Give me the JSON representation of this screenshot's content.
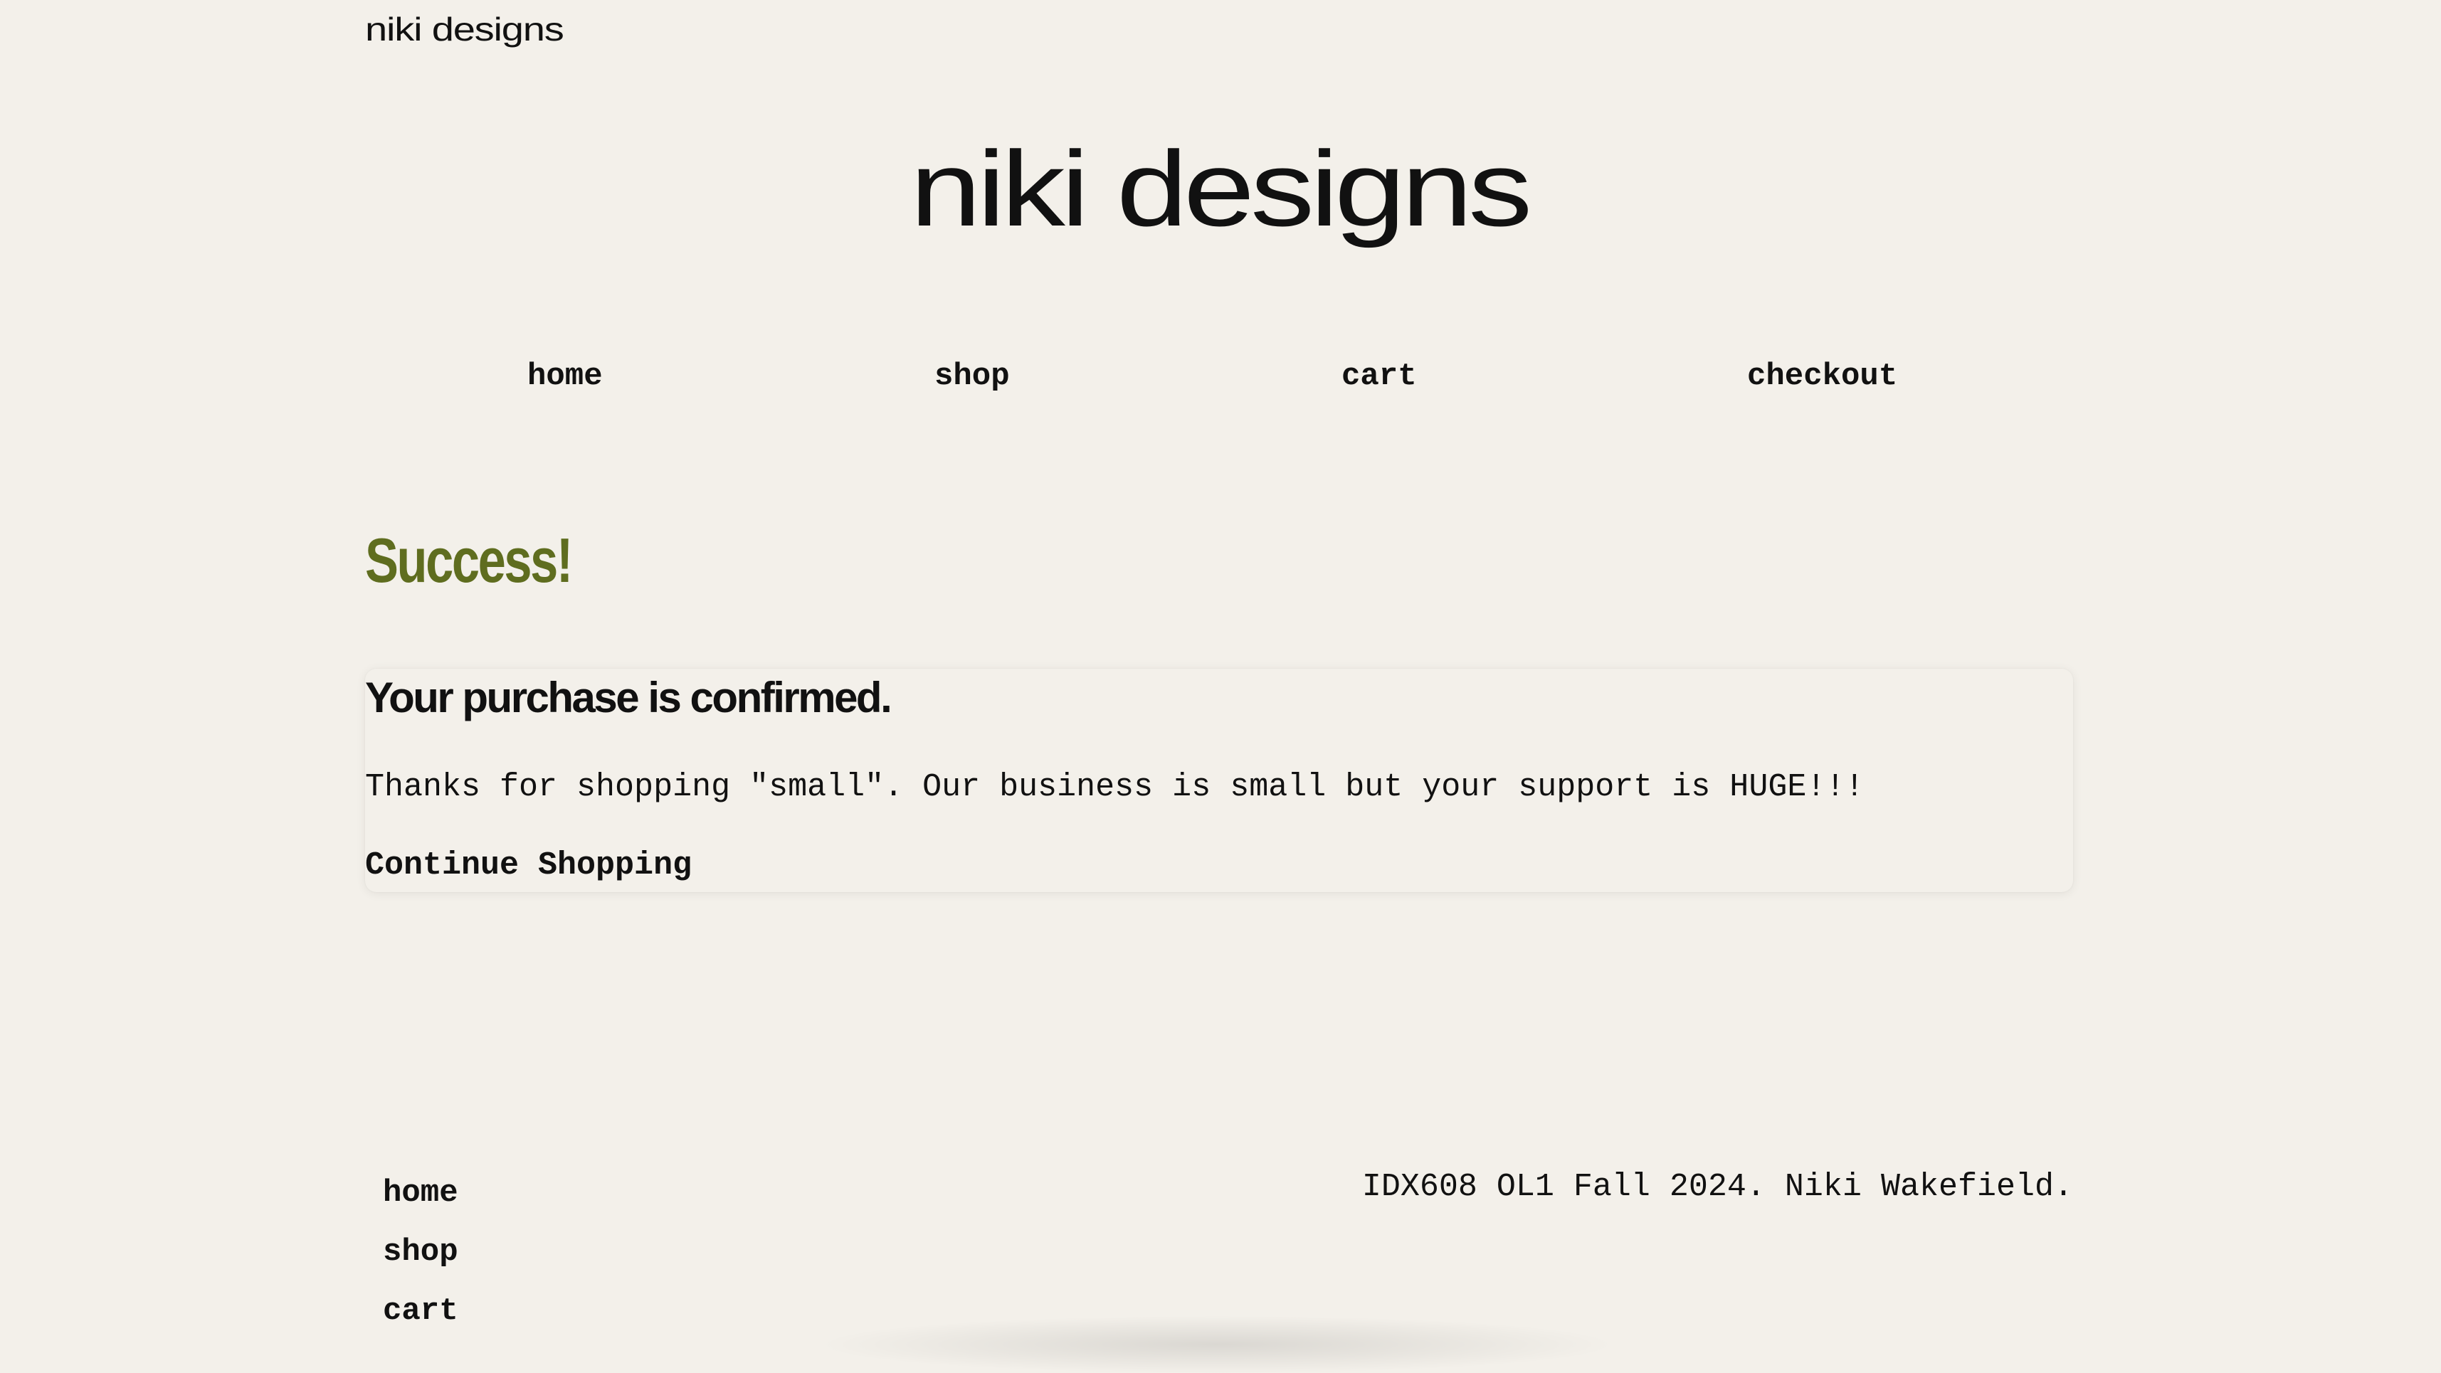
{
  "header": {
    "small_logo": "niki designs",
    "site_title": "niki designs"
  },
  "nav": {
    "items": [
      "home",
      "shop",
      "cart",
      "checkout"
    ]
  },
  "main": {
    "heading": "Success!",
    "card": {
      "title": "Your purchase is confirmed.",
      "message": "Thanks for shopping \"small\". Our business is small but your support is HUGE!!!",
      "continue_link": "Continue Shopping"
    }
  },
  "footer": {
    "nav": [
      "home",
      "shop",
      "cart"
    ],
    "credit": "IDX608 OL1 Fall 2024. Niki Wakefield."
  },
  "colors": {
    "background": "#f3f0ea",
    "accent": "#5f6d1f",
    "text": "#111111"
  }
}
